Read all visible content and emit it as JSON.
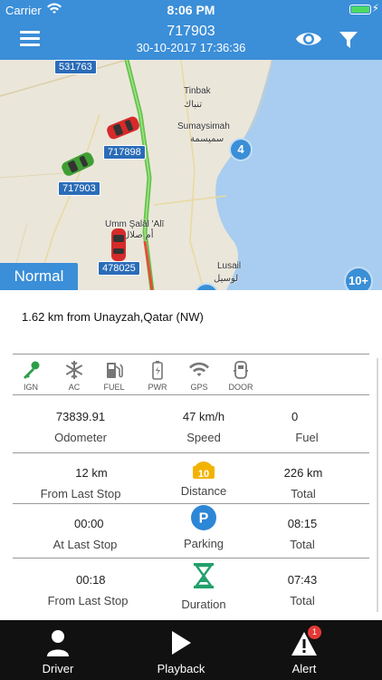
{
  "status_bar": {
    "carrier": "Carrier",
    "time": "8:06 PM"
  },
  "header": {
    "title": "717903",
    "subtitle": "30-10-2017 17:36:36"
  },
  "map": {
    "plates": [
      "531763",
      "717898",
      "717903",
      "478025"
    ],
    "places": [
      "Tinbak",
      "تنباك",
      "Sumaysimah",
      "سميسمة",
      "Umm Şalāl 'Alī",
      "أم صلال",
      "Lusail",
      "لوسيل"
    ],
    "clusters": [
      "4",
      "10+"
    ],
    "status_label": "Normal"
  },
  "address": "1.62 km from Unayzah,Qatar (NW)",
  "sensors": [
    {
      "label": "IGN",
      "icon": "key-icon",
      "color": "#2e9e4a"
    },
    {
      "label": "AC",
      "icon": "snowflake-icon",
      "color": "#777777"
    },
    {
      "label": "FUEL",
      "icon": "fuel-pump-icon",
      "color": "#777777"
    },
    {
      "label": "PWR",
      "icon": "battery-icon",
      "color": "#777777"
    },
    {
      "label": "GPS",
      "icon": "wifi-signal-icon",
      "color": "#777777"
    },
    {
      "label": "DOOR",
      "icon": "car-door-icon",
      "color": "#777777"
    }
  ],
  "stats": {
    "row1": {
      "odometer_value": "73839.91",
      "odometer_label": "Odometer",
      "speed_value": "47 km/h",
      "speed_label": "Speed",
      "fuel_value": "0",
      "fuel_label": "Fuel"
    },
    "row2": {
      "left_value": "12 km",
      "left_label": "From Last Stop",
      "mid_icon_text": "10",
      "mid_label": "Distance",
      "right_value": "226 km",
      "right_label": "Total"
    },
    "row3": {
      "left_value": "00:00",
      "left_label": "At Last Stop",
      "mid_icon_text": "P",
      "mid_label": "Parking",
      "right_value": "08:15",
      "right_label": "Total"
    },
    "row4": {
      "left_value": "00:18",
      "left_label": "From Last Stop",
      "mid_label": "Duration",
      "right_value": "07:43",
      "right_label": "Total"
    }
  },
  "tabs": [
    {
      "label": "Driver",
      "icon": "person-icon"
    },
    {
      "label": "Playback",
      "icon": "play-icon"
    },
    {
      "label": "Alert",
      "icon": "alert-icon",
      "badge": "1"
    }
  ]
}
